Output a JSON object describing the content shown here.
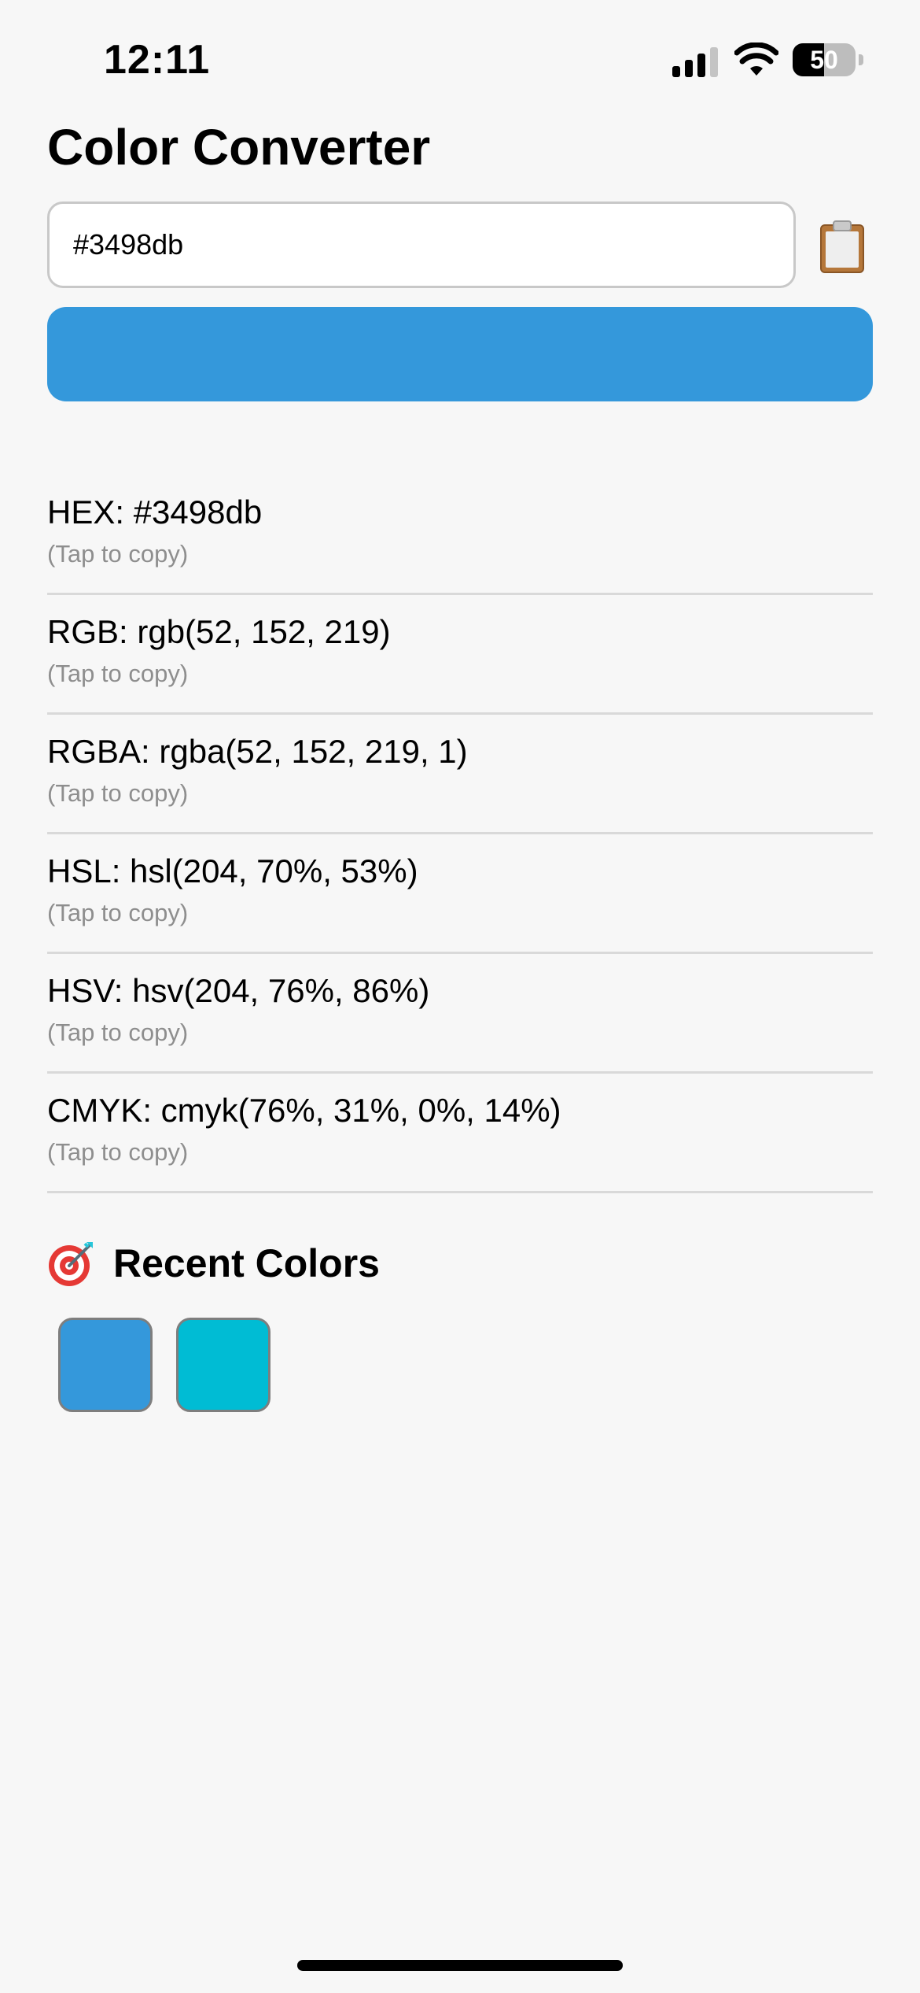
{
  "status_bar": {
    "time": "12:11",
    "battery_level": "50",
    "battery_fraction": 0.5,
    "signal_bars_active": 3,
    "signal_bars_total": 4,
    "icons": [
      "signal-icon",
      "wifi-icon",
      "battery-icon"
    ]
  },
  "page": {
    "title": "Color Converter"
  },
  "input": {
    "value": "#3498db",
    "paste_icon": "clipboard-icon"
  },
  "preview": {
    "color": "#3498db"
  },
  "formats": [
    {
      "id": "hex",
      "value": "HEX: #3498db",
      "hint": "(Tap to copy)"
    },
    {
      "id": "rgb",
      "value": "RGB: rgb(52, 152, 219)",
      "hint": "(Tap to copy)"
    },
    {
      "id": "rgba",
      "value": "RGBA: rgba(52, 152, 219, 1)",
      "hint": "(Tap to copy)"
    },
    {
      "id": "hsl",
      "value": "HSL: hsl(204, 70%, 53%)",
      "hint": "(Tap to copy)"
    },
    {
      "id": "hsv",
      "value": "HSV: hsv(204, 76%, 86%)",
      "hint": "(Tap to copy)"
    },
    {
      "id": "cmyk",
      "value": "CMYK: cmyk(76%, 31%, 0%, 14%)",
      "hint": "(Tap to copy)"
    }
  ],
  "recent": {
    "title": "Recent Colors",
    "icon": "target-icon",
    "colors": [
      "#3498db",
      "#00bcd4"
    ]
  },
  "colors": {
    "background": "#f7f7f7",
    "divider": "#d9d9d9",
    "hint_text": "#8e8e8e"
  }
}
